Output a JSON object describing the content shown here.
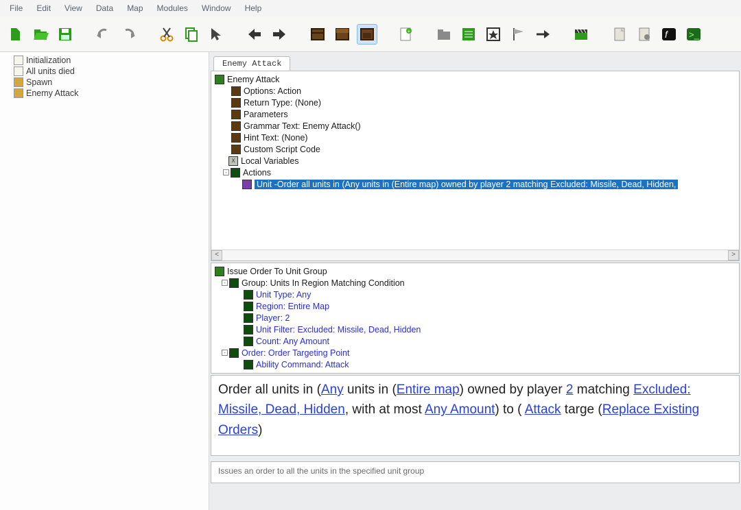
{
  "menu": {
    "items": [
      "File",
      "Edit",
      "View",
      "Data",
      "Map",
      "Modules",
      "Window",
      "Help"
    ]
  },
  "toolbar": {
    "icons": [
      "new",
      "open",
      "save",
      "undo",
      "redo",
      "cut",
      "copy",
      "paste",
      "arrow-left",
      "arrow-right",
      "box-1",
      "box-2",
      "box-3",
      "page",
      "folder",
      "script",
      "star",
      "flag",
      "arrow-next",
      "clapper",
      "doc-1",
      "doc-2",
      "fx",
      "terminal"
    ]
  },
  "left": {
    "items": [
      "Initialization",
      "All units died",
      "Spawn",
      "Enemy Attack"
    ]
  },
  "tabs": {
    "active": "Enemy Attack"
  },
  "p1": {
    "root": "Enemy Attack",
    "rows": [
      {
        "k": "Options",
        "v": "Action"
      },
      {
        "k": "Return Type",
        "v": "(None)"
      },
      {
        "k": "Parameters",
        "v": ""
      },
      {
        "k": "Grammar Text",
        "v": "Enemy Attack()"
      },
      {
        "k": "Hint Text",
        "v": "(None)"
      },
      {
        "k": "Custom Script Code",
        "v": ""
      }
    ],
    "local": "Local Variables",
    "actions": "Actions",
    "action_text": "Unit -Order all units in (Any units in (Entire map) owned by player 2 matching Excluded: Missile, Dead, Hidden,"
  },
  "p2": {
    "root": "Issue Order To Unit Group",
    "group": "Group: Units In Region Matching Condition",
    "rows": [
      {
        "k": "Unit Type",
        "v": "Any"
      },
      {
        "k": "Region",
        "v": "Entire Map"
      },
      {
        "k": "Player",
        "v": "2"
      },
      {
        "k": "Unit Filter",
        "v": "Excluded: Missile, Dead, Hidden"
      },
      {
        "k": "Count",
        "v": "Any Amount"
      }
    ],
    "order": "Order: Order Targeting Point",
    "ability_k": "Ability Command",
    "ability_v": "Attack"
  },
  "p3": {
    "t0": "Order all units in (",
    "l0": "Any",
    "t1": " units in (",
    "l1": "Entire map",
    "t2": ") owned by player ",
    "l2": "2",
    "t3": " matching ",
    "l3": "Excluded: Missile, Dead, Hidden",
    "t4": ", with at most ",
    "l4": "Any Amount",
    "t5": ") to ( ",
    "l5": "Attack",
    "t6": " targe (",
    "l6": "Replace Existing Orders",
    "t7": ")"
  },
  "p4": {
    "text": "Issues an order to all the units in the specified unit group"
  }
}
